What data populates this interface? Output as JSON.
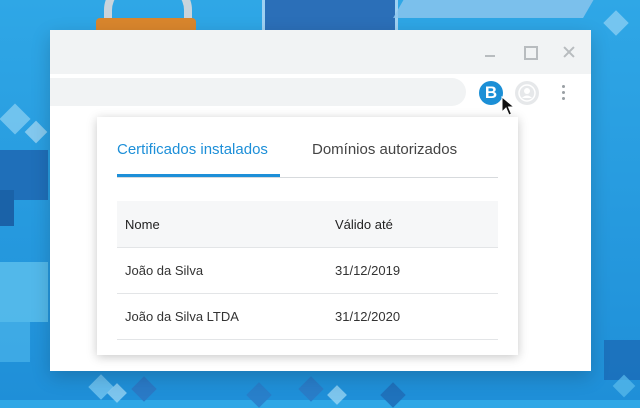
{
  "window": {
    "controls": {
      "minimize_icon": "minimize-icon",
      "maximize_icon": "maximize-icon",
      "close_icon": "close-icon"
    }
  },
  "toolbar": {
    "extension_label": "B",
    "extension_color": "#1b8fd6"
  },
  "popup": {
    "tabs": [
      {
        "label": "Certificados instalados",
        "active": true
      },
      {
        "label": "Domínios autorizados",
        "active": false
      }
    ],
    "table": {
      "columns": [
        "Nome",
        "Válido até"
      ],
      "rows": [
        [
          "João da Silva",
          "31/12/2019"
        ],
        [
          "João da Silva LTDA",
          "31/12/2020"
        ]
      ]
    }
  },
  "colors": {
    "accent": "#1d8fd8",
    "background": "#2fa7e6"
  }
}
